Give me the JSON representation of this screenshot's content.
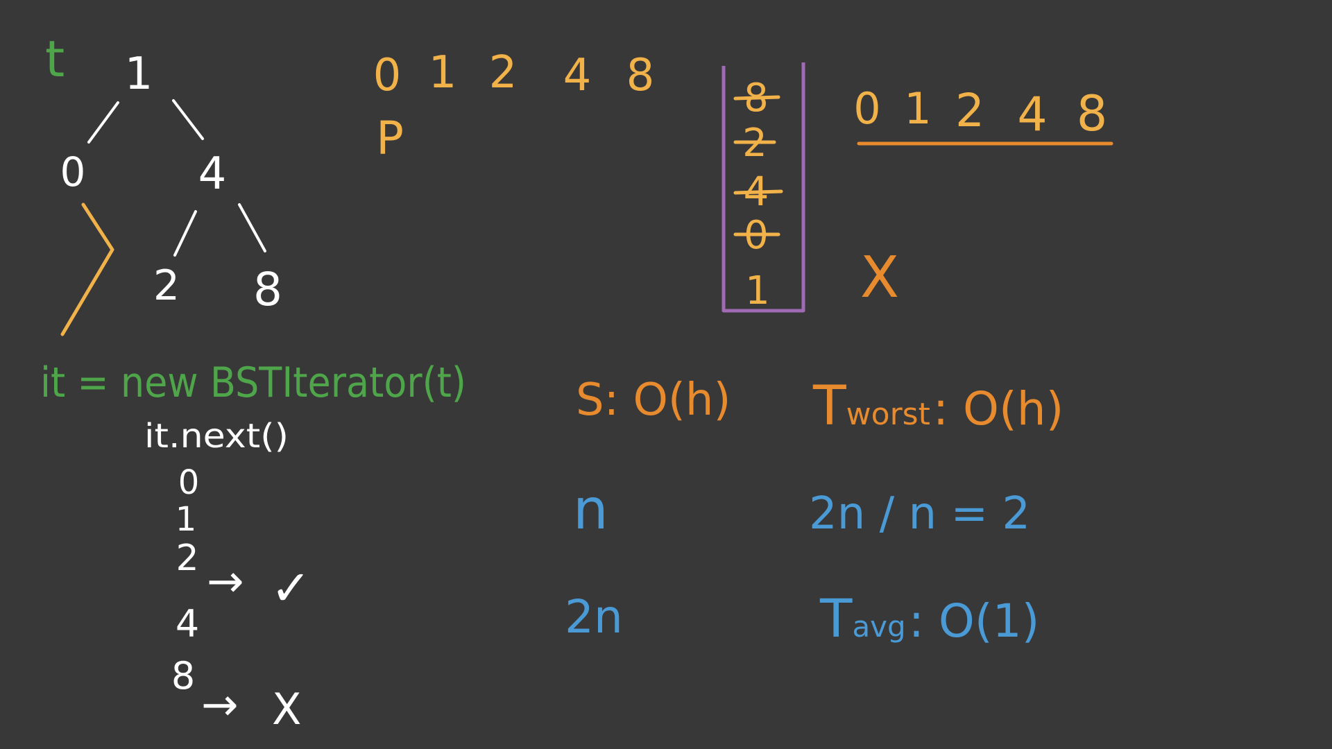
{
  "colors": {
    "background": "#383838",
    "white": "#ffffff",
    "green": "#4fa64a",
    "yellow": "#f2b24a",
    "orange": "#e88b2e",
    "purple": "#a06ab4",
    "blue": "#4a9ad6"
  },
  "tree": {
    "label": "t",
    "nodes": [
      "1",
      "0",
      "4",
      "2",
      "8"
    ]
  },
  "top_sequence": {
    "values": [
      "0",
      "1",
      "2",
      "4",
      "8"
    ],
    "pointer": "P"
  },
  "stack": {
    "items": [
      "8",
      "2",
      "4",
      "0",
      "1"
    ]
  },
  "right_sequence": {
    "values": [
      "0",
      "1",
      "2",
      "4",
      "8"
    ],
    "mark": "X"
  },
  "code": {
    "constructor_line": "it = new BSTIterator(t)",
    "call_line": "it.next()",
    "outputs": [
      "0",
      "1",
      "2",
      "4",
      "8"
    ],
    "check_mark": "✓",
    "cross_mark": "X",
    "arrow": "→"
  },
  "complexity": {
    "space_label": "S",
    "space_value": ": O(h)",
    "tworst_t": "T",
    "tworst_sub": "worst",
    "tworst_value": ": O(h)",
    "n_label": "n",
    "ratio": "2n / n = 2",
    "two_n_label": "2n",
    "tavg_t": "T",
    "tavg_sub": "avg",
    "tavg_value": ": O(1)"
  }
}
